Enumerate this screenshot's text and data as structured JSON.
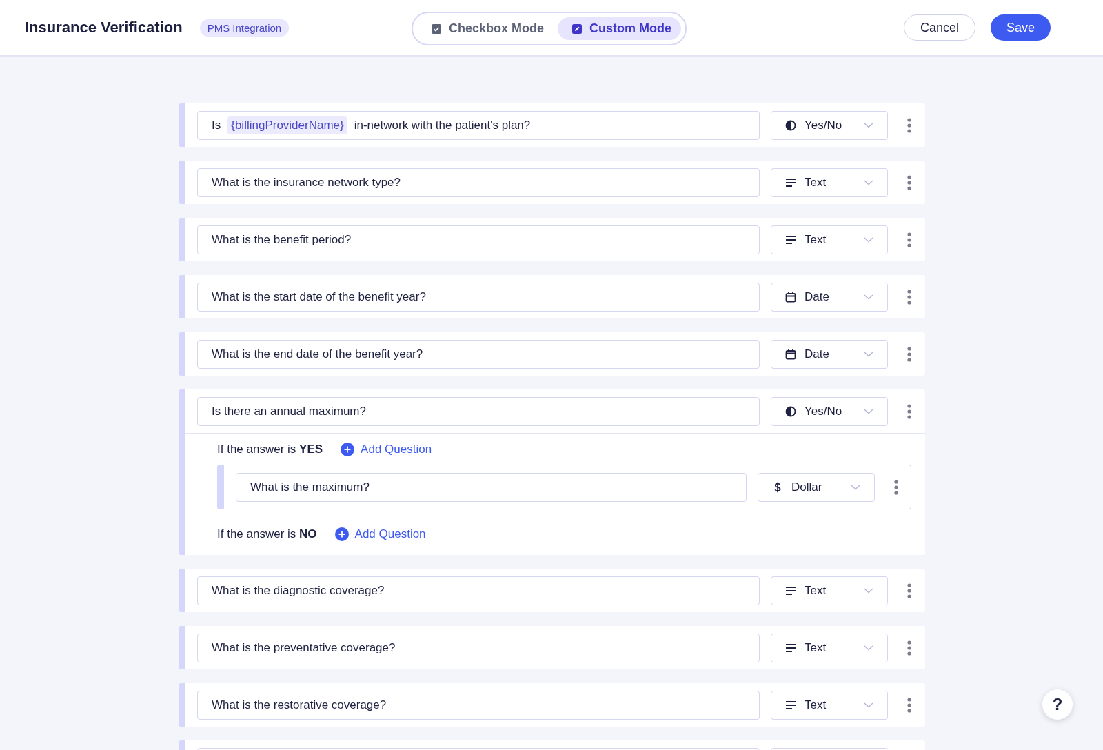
{
  "header": {
    "title": "Insurance Verification",
    "badge": "PMS Integration",
    "modes": [
      {
        "label": "Checkbox Mode",
        "kind": "checkbox",
        "selected": false
      },
      {
        "label": "Custom Mode",
        "kind": "custom",
        "selected": true
      }
    ],
    "buttons": [
      {
        "label": "Cancel",
        "kind": "secondary"
      },
      {
        "label": "Save",
        "kind": "primary"
      }
    ]
  },
  "questions": [
    {
      "segments": [
        {
          "kind": "text",
          "text": "Is"
        },
        {
          "kind": "token",
          "text": "{billingProviderName}"
        },
        {
          "kind": "text",
          "text": "in-network with the patient's plan?"
        }
      ],
      "type": {
        "kind": "yesno",
        "label": "Yes/No"
      }
    },
    {
      "segments": [
        {
          "kind": "text",
          "text": "What is the insurance network type?"
        }
      ],
      "type": {
        "kind": "text",
        "label": "Text"
      }
    },
    {
      "segments": [
        {
          "kind": "text",
          "text": "What is the benefit period?"
        }
      ],
      "type": {
        "kind": "text",
        "label": "Text"
      }
    },
    {
      "segments": [
        {
          "kind": "text",
          "text": "What is the start date of the benefit year?"
        }
      ],
      "type": {
        "kind": "date",
        "label": "Date"
      }
    },
    {
      "segments": [
        {
          "kind": "text",
          "text": "What is the end date of the benefit year?"
        }
      ],
      "type": {
        "kind": "date",
        "label": "Date"
      }
    },
    {
      "segments": [
        {
          "kind": "text",
          "text": "Is there an annual maximum?"
        }
      ],
      "type": {
        "kind": "yesno",
        "label": "Yes/No"
      },
      "branches": [
        {
          "label": "If the answer is **YES**",
          "action": "Add Question",
          "questions": [
            {
              "segments": [
                {
                  "kind": "text",
                  "text": "What is the maximum?"
                }
              ],
              "type": {
                "kind": "dollar",
                "label": "Dollar"
              }
            }
          ]
        },
        {
          "label": "If the answer is **NO**",
          "action": "Add Question"
        }
      ]
    },
    {
      "segments": [
        {
          "kind": "text",
          "text": "What is the diagnostic coverage?"
        }
      ],
      "type": {
        "kind": "text",
        "label": "Text"
      }
    },
    {
      "segments": [
        {
          "kind": "text",
          "text": "What is the preventative coverage?"
        }
      ],
      "type": {
        "kind": "text",
        "label": "Text"
      }
    },
    {
      "segments": [
        {
          "kind": "text",
          "text": "What is the restorative coverage?"
        }
      ],
      "type": {
        "kind": "text",
        "label": "Text"
      }
    }
  ],
  "help": {
    "label": "?"
  }
}
